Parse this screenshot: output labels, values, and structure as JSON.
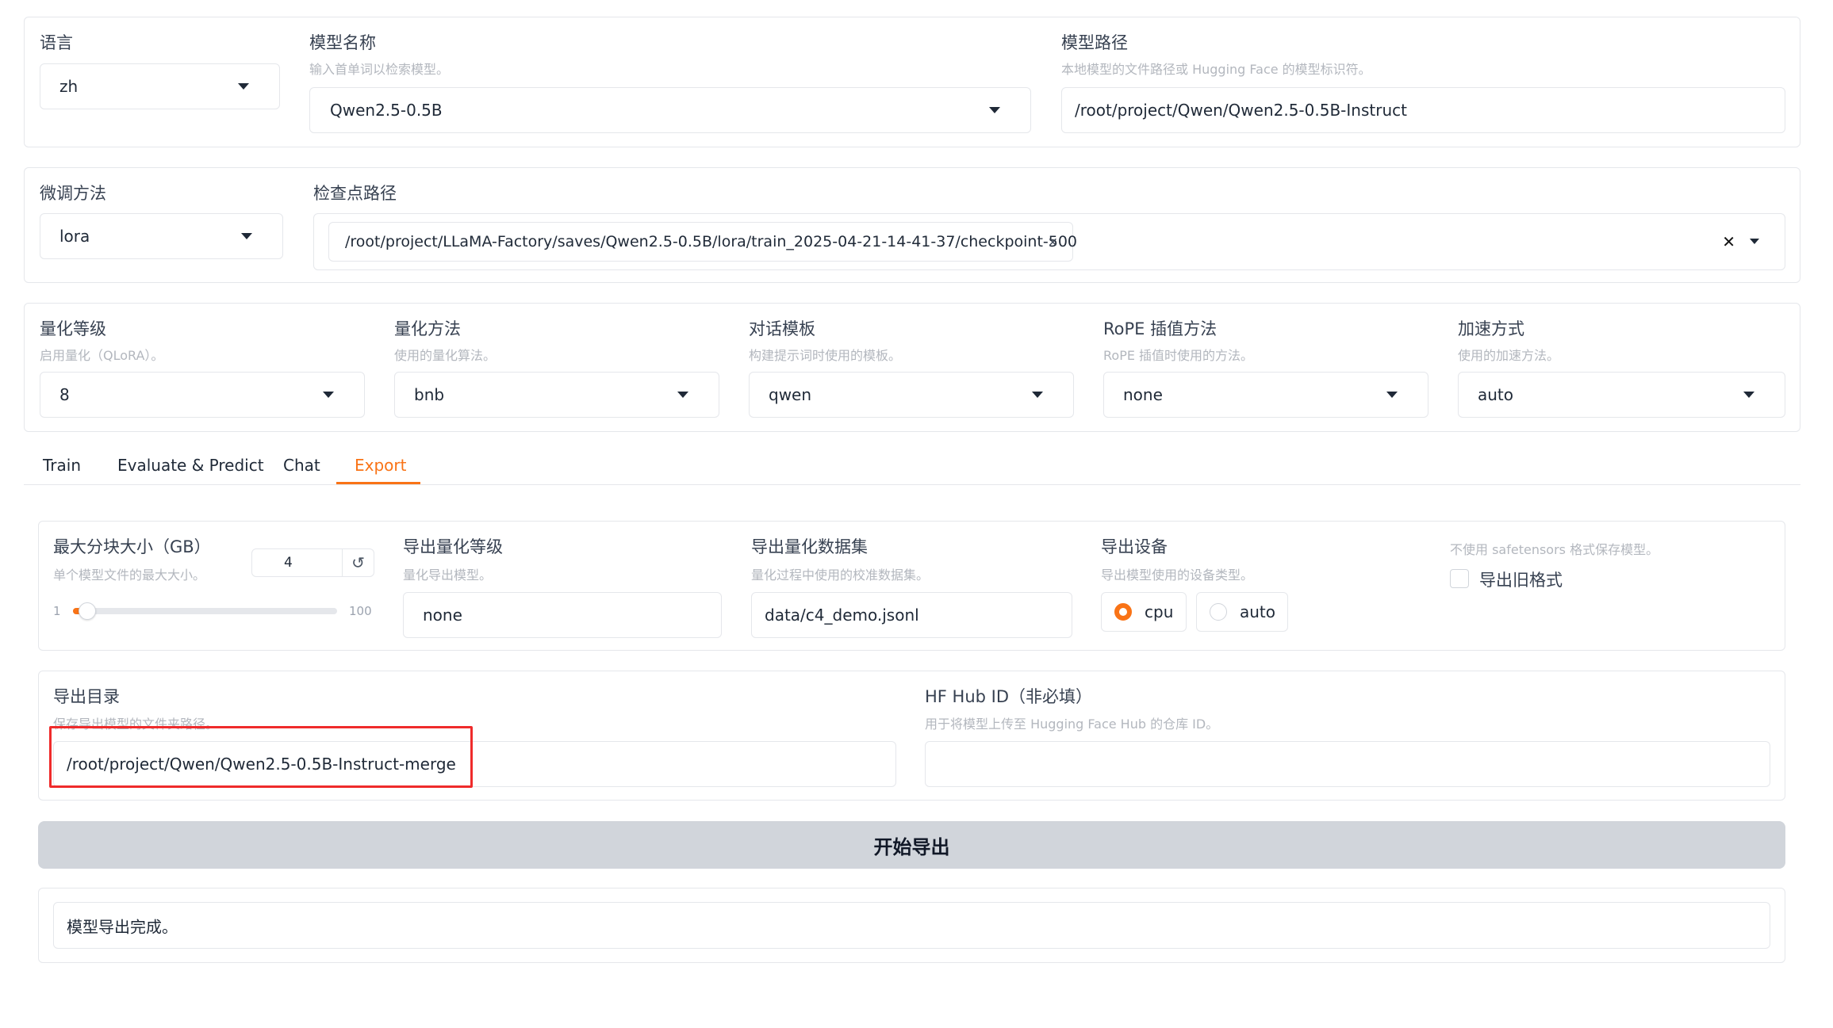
{
  "top": {
    "lang": {
      "label": "语言",
      "value": "zh"
    },
    "model_name": {
      "label": "模型名称",
      "info": "输入首单词以检索模型。",
      "value": "Qwen2.5-0.5B"
    },
    "model_path": {
      "label": "模型路径",
      "info": "本地模型的文件路径或 Hugging Face 的模型标识符。",
      "value": "/root/project/Qwen/Qwen2.5-0.5B-Instruct"
    }
  },
  "finetune": {
    "method": {
      "label": "微调方法",
      "value": "lora"
    },
    "checkpoint": {
      "label": "检查点路径",
      "chip": "/root/project/LLaMA-Factory/saves/Qwen2.5-0.5B/lora/train_2025-04-21-14-41-37/checkpoint-500",
      "chip_remove": "×",
      "clear": "✕"
    }
  },
  "advanced": {
    "quant_bit": {
      "label": "量化等级",
      "info": "启用量化（QLoRA）。",
      "value": "8"
    },
    "quant_method": {
      "label": "量化方法",
      "info": "使用的量化算法。",
      "value": "bnb"
    },
    "template": {
      "label": "对话模板",
      "info": "构建提示词时使用的模板。",
      "value": "qwen"
    },
    "rope": {
      "label": "RoPE 插值方法",
      "info": "RoPE 插值时使用的方法。",
      "value": "none"
    },
    "booster": {
      "label": "加速方式",
      "info": "使用的加速方法。",
      "value": "auto"
    }
  },
  "tabs": [
    "Train",
    "Evaluate & Predict",
    "Chat",
    "Export"
  ],
  "active_tab": "Export",
  "export": {
    "shard_size": {
      "label": "最大分块大小（GB）",
      "info": "单个模型文件的最大大小。",
      "value": "4",
      "min": "1",
      "max": "100",
      "level": 0.03,
      "reset": "↺"
    },
    "export_quant_bit": {
      "label": "导出量化等级",
      "info": "量化导出模型。",
      "value": "none"
    },
    "export_quant_dataset": {
      "label": "导出量化数据集",
      "info": "量化过程中使用的校准数据集。",
      "value": "data/c4_demo.jsonl"
    },
    "export_device": {
      "label": "导出设备",
      "info": "导出模型使用的设备类型。",
      "options": [
        "cpu",
        "auto"
      ],
      "selected": "cpu"
    },
    "legacy_format": {
      "info": "不使用 safetensors 格式保存模型。",
      "label": "导出旧格式",
      "checked": false
    },
    "export_dir": {
      "label": "导出目录",
      "info": "保存导出模型的文件夹路径。",
      "value": "/root/project/Qwen/Qwen2.5-0.5B-Instruct-merge"
    },
    "hub_id": {
      "label": "HF Hub ID（非必填）",
      "info": "用于将模型上传至 Hugging Face Hub 的仓库 ID。",
      "value": ""
    },
    "start_button": "开始导出",
    "output": "模型导出完成。"
  },
  "colors": {
    "accent": "#f97316",
    "highlight": "#ef2b2b",
    "button_bg": "#d1d5db"
  }
}
